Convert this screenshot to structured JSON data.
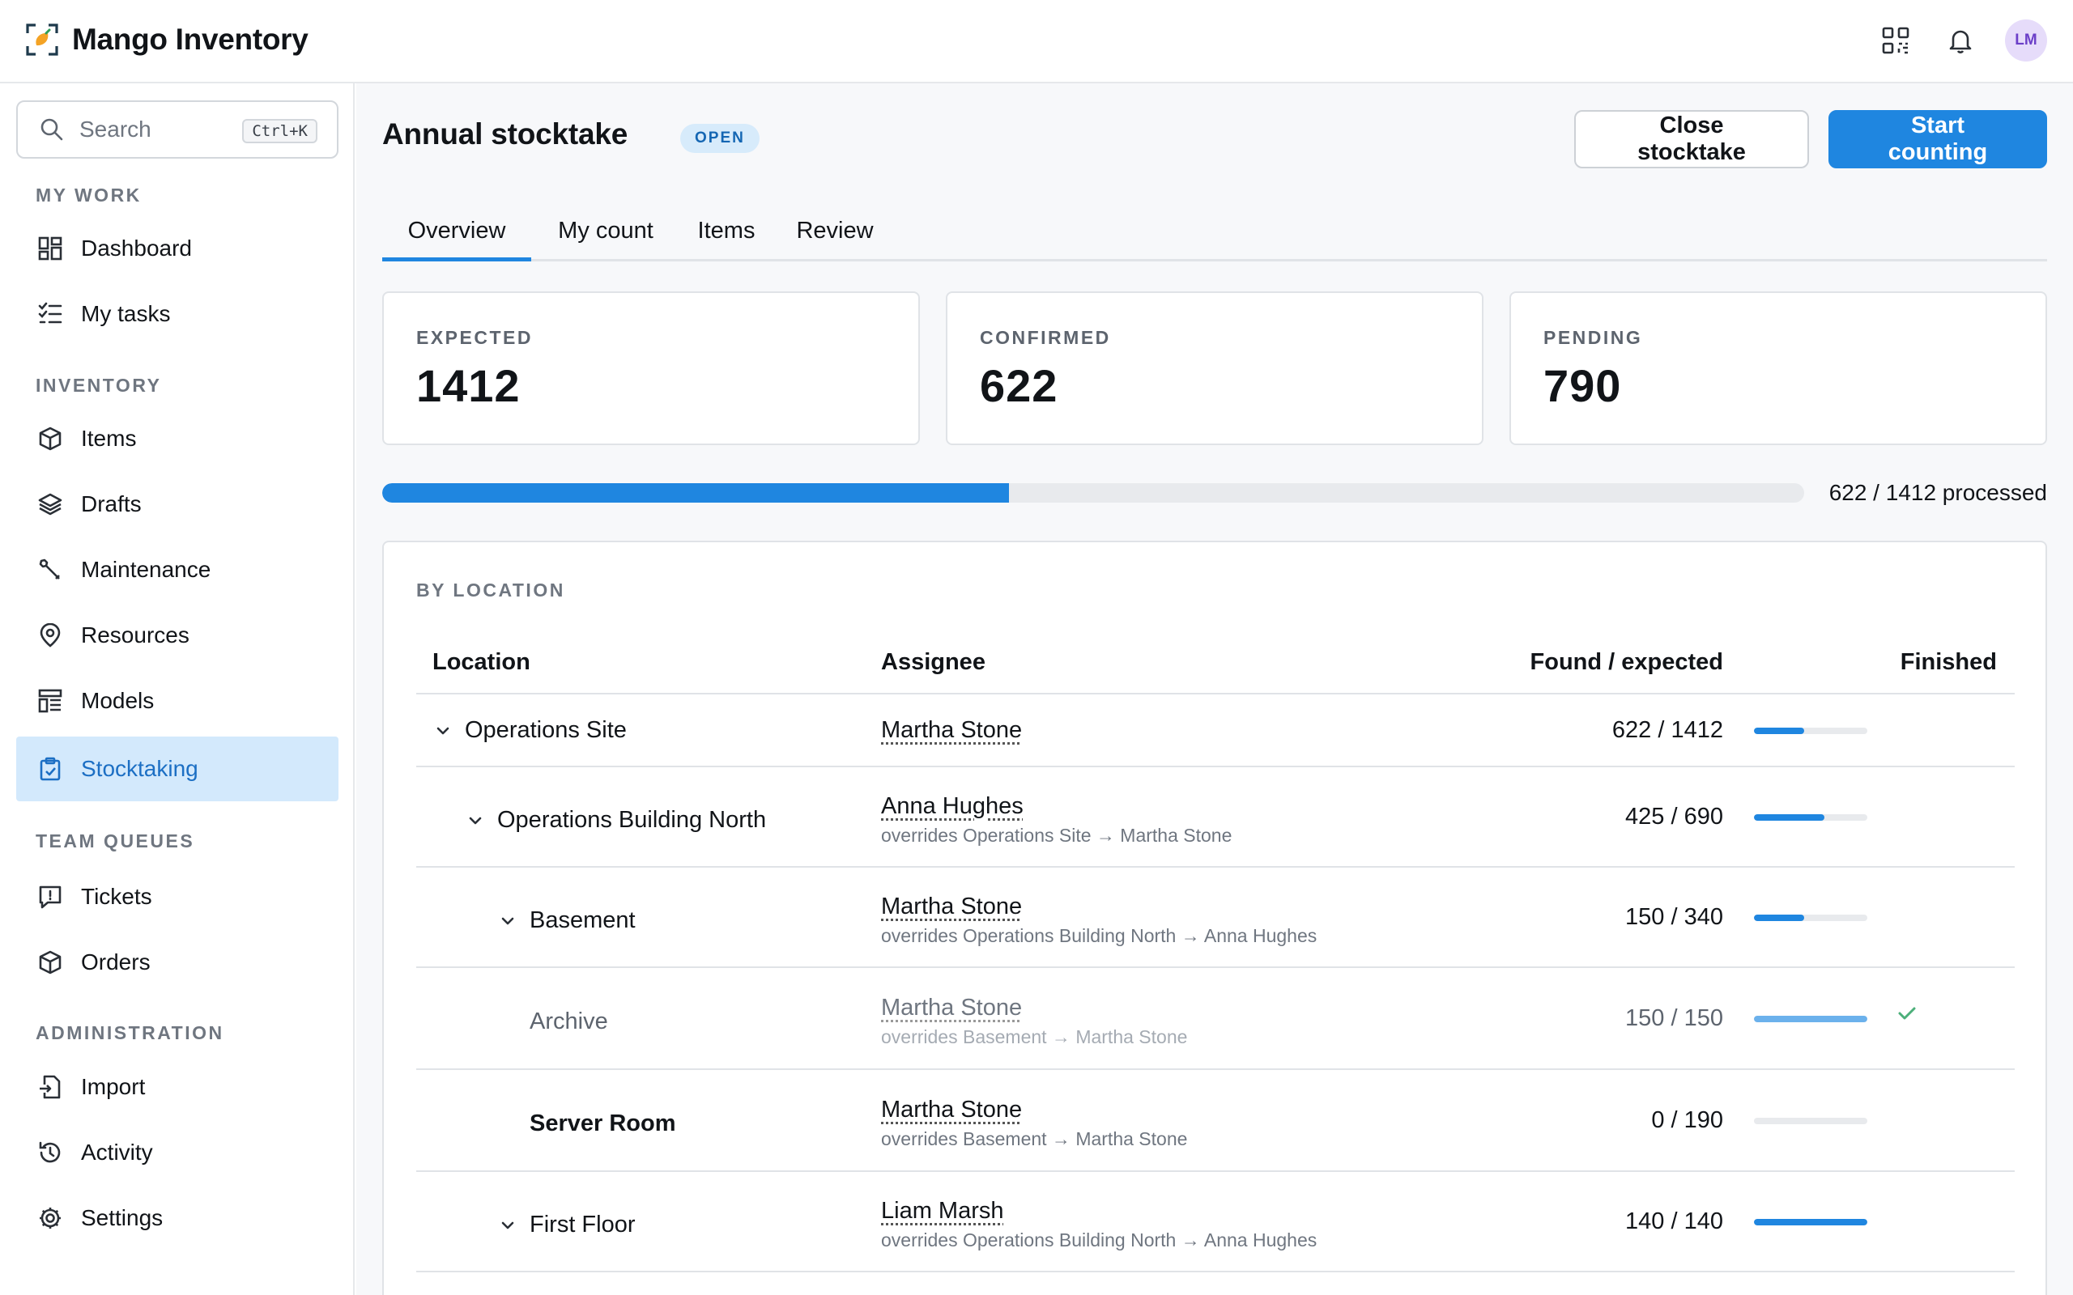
{
  "app": {
    "name": "Mango Inventory",
    "avatar_initials": "LM"
  },
  "search": {
    "placeholder": "Search",
    "shortcut": "Ctrl+K"
  },
  "sidebar": {
    "sections": [
      {
        "title": "MY WORK",
        "items": [
          {
            "label": "Dashboard",
            "icon": "dashboard-icon"
          },
          {
            "label": "My tasks",
            "icon": "tasks-icon"
          }
        ]
      },
      {
        "title": "INVENTORY",
        "items": [
          {
            "label": "Items",
            "icon": "cube-icon"
          },
          {
            "label": "Drafts",
            "icon": "layers-icon"
          },
          {
            "label": "Maintenance",
            "icon": "wrench-icon"
          },
          {
            "label": "Resources",
            "icon": "location-pin-icon"
          },
          {
            "label": "Models",
            "icon": "models-icon"
          },
          {
            "label": "Stocktaking",
            "icon": "clipboard-check-icon",
            "active": true
          }
        ]
      },
      {
        "title": "TEAM QUEUES",
        "items": [
          {
            "label": "Tickets",
            "icon": "ticket-icon"
          },
          {
            "label": "Orders",
            "icon": "cube-icon"
          }
        ]
      },
      {
        "title": "ADMINISTRATION",
        "items": [
          {
            "label": "Import",
            "icon": "import-icon"
          },
          {
            "label": "Activity",
            "icon": "history-icon"
          },
          {
            "label": "Settings",
            "icon": "gear-icon"
          }
        ]
      }
    ]
  },
  "header": {
    "title": "Annual stocktake",
    "status": "OPEN",
    "close_label": "Close stocktake",
    "start_label": "Start counting"
  },
  "tabs": [
    {
      "label": "Overview",
      "active": true
    },
    {
      "label": "My count"
    },
    {
      "label": "Items"
    },
    {
      "label": "Review"
    }
  ],
  "stats": [
    {
      "label": "EXPECTED",
      "value": "1412"
    },
    {
      "label": "CONFIRMED",
      "value": "622"
    },
    {
      "label": "PENDING",
      "value": "790"
    }
  ],
  "progress": {
    "fraction": 0.4405,
    "text": "622 / 1412 processed"
  },
  "by_location": {
    "title": "BY LOCATION",
    "columns": {
      "location": "Location",
      "assignee": "Assignee",
      "found": "Found / expected",
      "finished": "Finished"
    },
    "rows": [
      {
        "location": "Operations Site",
        "level": 0,
        "expandable": true,
        "assignee": "Martha Stone",
        "override": "",
        "found": "622 / 1412",
        "fraction": 0.44,
        "finished": false
      },
      {
        "location": "Operations Building North",
        "level": 1,
        "expandable": true,
        "assignee": "Anna Hughes",
        "override": "overrides Operations Site → Martha Stone",
        "found": "425 / 690",
        "fraction": 0.62,
        "finished": false
      },
      {
        "location": "Basement",
        "level": 2,
        "expandable": true,
        "assignee": "Martha Stone",
        "override": "overrides Operations Building North → Anna Hughes",
        "found": "150 / 340",
        "fraction": 0.44,
        "finished": false
      },
      {
        "location": "Archive",
        "level": 3,
        "expandable": false,
        "assignee": "Martha Stone",
        "override": "overrides Basement → Martha Stone",
        "found": "150 / 150",
        "fraction": 1.0,
        "finished": true,
        "dim": true
      },
      {
        "location": "Server Room",
        "level": 3,
        "expandable": false,
        "bold": true,
        "assignee": "Martha Stone",
        "override": "overrides Basement → Martha Stone",
        "found": "0 / 190",
        "fraction": 0.0,
        "finished": false
      },
      {
        "location": "First Floor",
        "level": 2,
        "expandable": true,
        "assignee": "Liam Marsh",
        "override": "overrides Operations Building North → Anna Hughes",
        "found": "140 / 140",
        "fraction": 1.0,
        "finished": false
      }
    ]
  },
  "colors": {
    "accent": "#1f86e0",
    "active_bg": "#d3e9fc",
    "pill_bg": "#d7ebfb",
    "check": "#4caf7a"
  }
}
